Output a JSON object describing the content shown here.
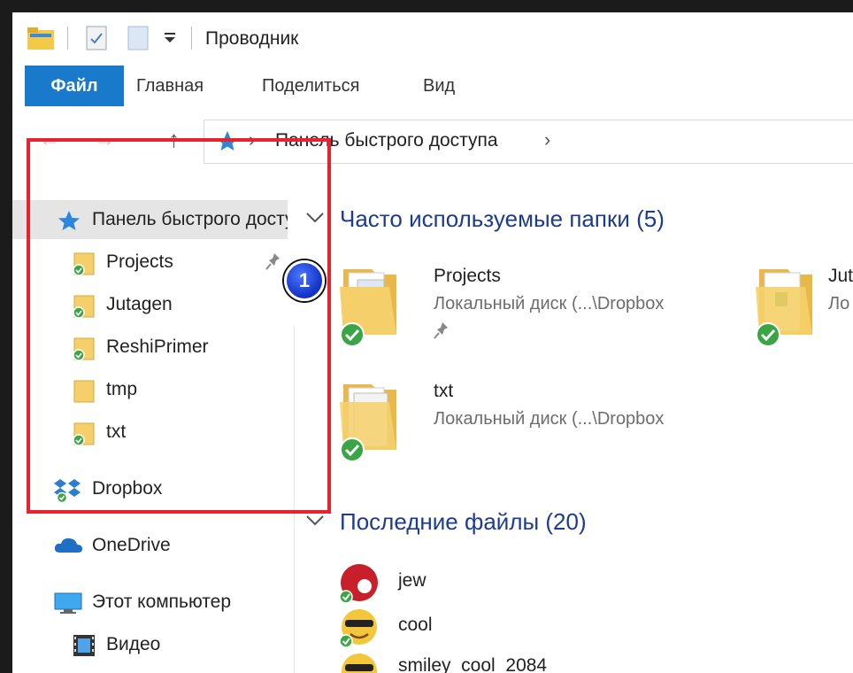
{
  "title_bar": {
    "title": "Проводник"
  },
  "ribbon": {
    "tabs": [
      "Файл",
      "Главная",
      "Поделиться",
      "Вид"
    ]
  },
  "address": {
    "crumb": "Панель быстрого доступа",
    "chevron": "›"
  },
  "nav": {
    "quick_access": "Панель быстрого доступа",
    "pinned": [
      {
        "label": "Projects",
        "synced": true,
        "pinned": true
      },
      {
        "label": "Jutagen",
        "synced": true
      },
      {
        "label": "ReshiPrimer",
        "synced": true
      },
      {
        "label": "tmp",
        "synced": false
      },
      {
        "label": "txt",
        "synced": true
      }
    ],
    "dropbox": "Dropbox",
    "onedrive": "OneDrive",
    "this_pc": "Этот компьютер",
    "video": "Видео"
  },
  "annotation": {
    "number": "1"
  },
  "content": {
    "frequent": {
      "title": "Часто используемые папки (5)",
      "folders": [
        {
          "name": "Projects",
          "location": "Локальный диск (...\\Dropbox"
        },
        {
          "name": "Jut",
          "location": "Ло"
        },
        {
          "name": "txt",
          "location": "Локальный диск (...\\Dropbox"
        }
      ]
    },
    "recent": {
      "title": "Последние файлы (20)",
      "files": [
        "jew",
        "cool",
        "smiley_cool_2084"
      ]
    }
  },
  "colors": {
    "accent": "#1979ca",
    "annotation_box": "#e8232d",
    "group_heading": "#1e3c8c",
    "selection": "#e5e5e5"
  }
}
